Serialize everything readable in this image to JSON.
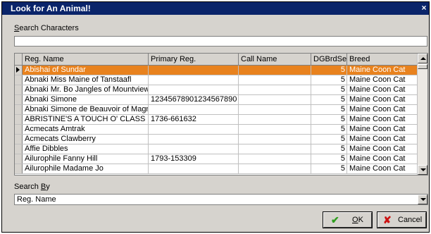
{
  "window": {
    "title": "Look for An Animal!",
    "close_glyph": "×"
  },
  "search": {
    "label_prefix": "S",
    "label_rest": "earch Characters",
    "value": "",
    "placeholder": ""
  },
  "grid": {
    "columns": [
      "Reg. Name",
      "Primary Reg.",
      "Call Name",
      "DGBrdSer",
      "Breed"
    ],
    "rows": [
      [
        "Abishai of Sundar",
        "",
        "",
        "5",
        "Maine Coon Cat"
      ],
      [
        "Abnaki Miss Maine of Tanstaafl",
        "",
        "",
        "5",
        "Maine Coon Cat"
      ],
      [
        "Abnaki Mr. Bo Jangles of Mountview",
        "",
        "",
        "5",
        "Maine Coon Cat"
      ],
      [
        "Abnaki Simone",
        "12345678901234567890",
        "",
        "5",
        "Maine Coon Cat"
      ],
      [
        "Abnaki Simone de Beauvoir of Magnificats",
        "",
        "",
        "5",
        "Maine Coon Cat"
      ],
      [
        "ABRISTINE'S A TOUCH O' CLASS",
        "1736-661632",
        "",
        "5",
        "Maine Coon Cat"
      ],
      [
        "Acmecats Amtrak",
        "",
        "",
        "5",
        "Maine Coon Cat"
      ],
      [
        "Acmecats Clawberry",
        "",
        "",
        "5",
        "Maine Coon Cat"
      ],
      [
        "Affie Dibbles",
        "",
        "",
        "5",
        "Maine Coon Cat"
      ],
      [
        "Ailurophile Fanny Hill",
        "1793-153309",
        "",
        "5",
        "Maine Coon Cat"
      ],
      [
        "Ailurophile Madame Jo",
        "",
        "",
        "5",
        "Maine Coon Cat"
      ]
    ],
    "selected_row": 0
  },
  "search_by": {
    "label_prefix": "Search ",
    "label_underlined": "B",
    "label_rest": "y",
    "selected": "Reg. Name"
  },
  "buttons": {
    "ok_label_underlined": "O",
    "ok_label_rest": "K",
    "cancel_label": "Cancel"
  },
  "colors": {
    "titlebar": "#0a246a",
    "selection": "#e8821e",
    "ok_icon": "#2e9e1e",
    "cancel_icon": "#cc1010"
  }
}
